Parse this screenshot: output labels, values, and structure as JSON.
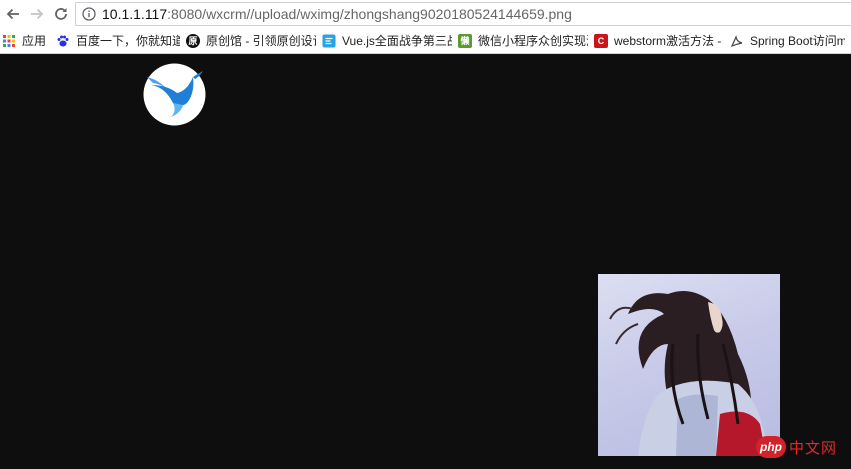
{
  "toolbar": {
    "url_host": "10.1.1.117",
    "url_rest": ":8080/wxcrm//upload/wximg/zhongshang9020180524144659.png"
  },
  "bookmarks": [
    {
      "label": "应用",
      "icon": "apps-grid-icon"
    },
    {
      "label": "百度一下，你就知道",
      "icon": "baidu-paw-icon"
    },
    {
      "label": "原创馆 - 引领原创设计",
      "icon": "yuanchuang-icon",
      "icon_text": "原"
    },
    {
      "label": "Vue.js全面战争第三战",
      "icon": "vue-article-icon"
    },
    {
      "label": "微信小程序众创实现源码",
      "icon": "wechat-mini-icon",
      "icon_text": "懒"
    },
    {
      "label": "webstorm激活方法 - CSDN",
      "icon": "csdn-icon",
      "icon_text": "C"
    },
    {
      "label": "Spring Boot访问mysql",
      "icon": "spring-leaf-icon"
    }
  ],
  "watermark": {
    "badge": "php",
    "text": "中文网"
  },
  "colors": {
    "page_bg": "#0e0e0e",
    "watermark_red": "#d2232a"
  }
}
